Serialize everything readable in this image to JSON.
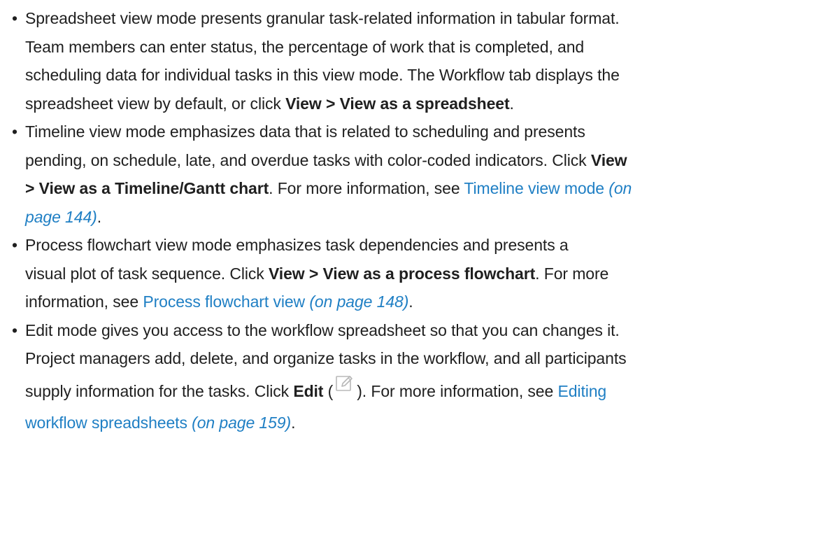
{
  "bullets": [
    {
      "lines": [
        "Spreadsheet view mode presents granular task-related information in tabular format.",
        "Team members can enter status, the percentage of work that is completed, and",
        "scheduling data for individual tasks in this view mode. The Workflow tab displays the"
      ],
      "last_prefix": "spreadsheet view by default, or click ",
      "last_bold": "View > View as a spreadsheet",
      "last_suffix": "."
    },
    {
      "line1": "Timeline view mode emphasizes data that is related to scheduling and presents",
      "line2_text": "pending, on schedule, late, and overdue tasks with color-coded indicators. Click ",
      "line2_bold": "View",
      "line3_bold": "> View as a Timeline/Gantt chart",
      "line3_text": ". For more information, see ",
      "link_text": "Timeline view mode",
      "link_page_a": "(on",
      "link_page_b": "page 144)",
      "end": "."
    },
    {
      "line1": "Process flowchart view mode emphasizes task dependencies and presents a",
      "line2_text": "visual plot of task sequence. Click ",
      "line2_bold": "View > View as a process flowchart",
      "line2_suffix": ". For more",
      "line3_text": "information, see ",
      "link_text": "Process flowchart view",
      "link_page": "(on page 148)",
      "end": "."
    },
    {
      "line1": "Edit mode gives you access to the workflow spreadsheet so that you can changes it.",
      "line2": "Project managers add, delete, and organize tasks in the workflow, and all participants",
      "line3_text": "supply information for the tasks. Click ",
      "line3_bold": "Edit",
      "line3_paren_open": " (",
      "line3_paren_close": "). For more information, see ",
      "link_text_a": "Editing",
      "link_text_b": "workflow spreadsheets",
      "link_page": "(on page 159)",
      "end": ".",
      "icon": "edit-icon"
    }
  ],
  "colors": {
    "text": "#1f1f1f",
    "link": "#1f7fc4"
  }
}
